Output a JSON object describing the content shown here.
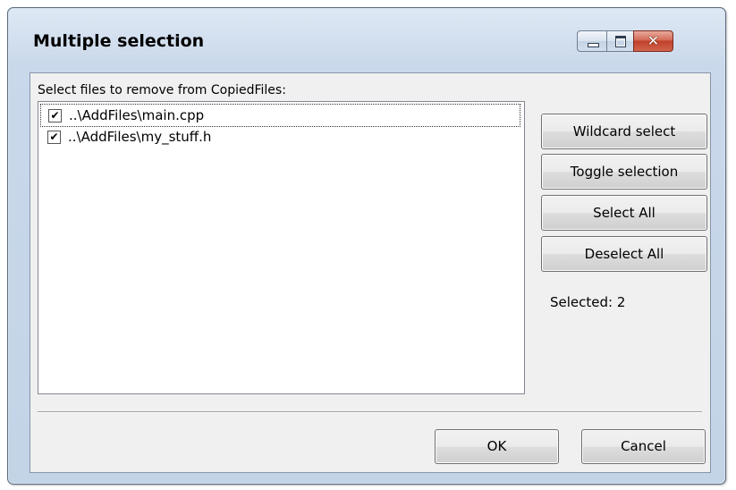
{
  "window": {
    "title": "Multiple selection",
    "controls": {
      "minimize": "minimize-icon",
      "maximize": "maximize-icon",
      "close": "close-icon",
      "close_glyph": "✕"
    }
  },
  "prompt": "Select files to remove from CopiedFiles:",
  "files": [
    {
      "label": "..\\AddFiles\\main.cpp",
      "checked": true,
      "check_glyph": "✔"
    },
    {
      "label": "..\\AddFiles\\my_stuff.h",
      "checked": true,
      "check_glyph": "✔"
    }
  ],
  "buttons": {
    "wildcard": "Wildcard select",
    "toggle": "Toggle selection",
    "select_all": "Select All",
    "deselect_all": "Deselect All",
    "ok": "OK",
    "cancel": "Cancel"
  },
  "status": "Selected: 2",
  "colors": {
    "frame": "#c3d4e7",
    "client": "#f0f0f0",
    "close_button": "#c0402a"
  }
}
